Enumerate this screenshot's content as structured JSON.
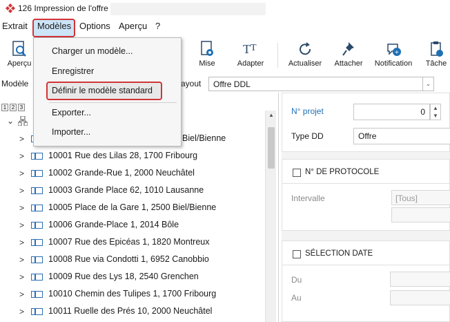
{
  "window": {
    "title": "126 Impression de l'offre"
  },
  "menubar": {
    "items": [
      "Extrait",
      "Modèles",
      "Options",
      "Aperçu",
      "?"
    ]
  },
  "toolbar": {
    "buttons": [
      {
        "label": "Aperçu",
        "icon": "preview-icon"
      },
      {
        "label": "Mise",
        "icon": "page-setup-icon"
      },
      {
        "label": "Adapter",
        "icon": "text-adapt-icon"
      },
      {
        "label": "Actualiser",
        "icon": "refresh-icon"
      },
      {
        "label": "Attacher",
        "icon": "pin-icon"
      },
      {
        "label": "Notification",
        "icon": "notification-icon"
      },
      {
        "label": "Tâche",
        "icon": "task-icon"
      }
    ]
  },
  "modele_row": {
    "label": "Modèle",
    "layout_label": "ayout",
    "layout_value": "Offre DDL"
  },
  "levels": [
    "1",
    "2",
    "3"
  ],
  "tree": {
    "root_partial": "Biel/Bienne",
    "rows": [
      "10001 Rue des Lilas 28, 1700 Fribourg",
      "10002 Grande-Rue 1, 2000 Neuchâtel",
      "10003 Grande Place 62, 1010 Lausanne",
      "10005 Place de la Gare 1, 2500 Biel/Bienne",
      "10006 Grande-Place 1, 2014 Bôle",
      "10007 Rue des Epicéas 1, 1820 Montreux",
      "10008 Rue via Condotti 1, 6952 Canobbio",
      "10009 Rue des Lys 18, 2540 Grenchen",
      "10010 Chemin des Tulipes 1, 1700 Fribourg",
      "10011 Ruelle des Prés 10, 2000 Neuchâtel"
    ]
  },
  "right": {
    "projet_label": "N° projet",
    "projet_value": "0",
    "type_label": "Type DD",
    "type_value": "Offre",
    "protocole_title": "N° DE PROTOCOLE",
    "intervalle_label": "Intervalle",
    "intervalle_value": "[Tous]",
    "date_title": "SÉLECTION DATE",
    "du_label": "Du",
    "au_label": "Au"
  },
  "dropdown": {
    "items": [
      "Charger un modèle...",
      "Enregistrer",
      "Définir le modèle standard",
      "Exporter...",
      "Importer..."
    ]
  },
  "colors": {
    "accent": "#1f6fb5",
    "highlight_border": "#d13438",
    "menu_active": "#cce4f7"
  }
}
